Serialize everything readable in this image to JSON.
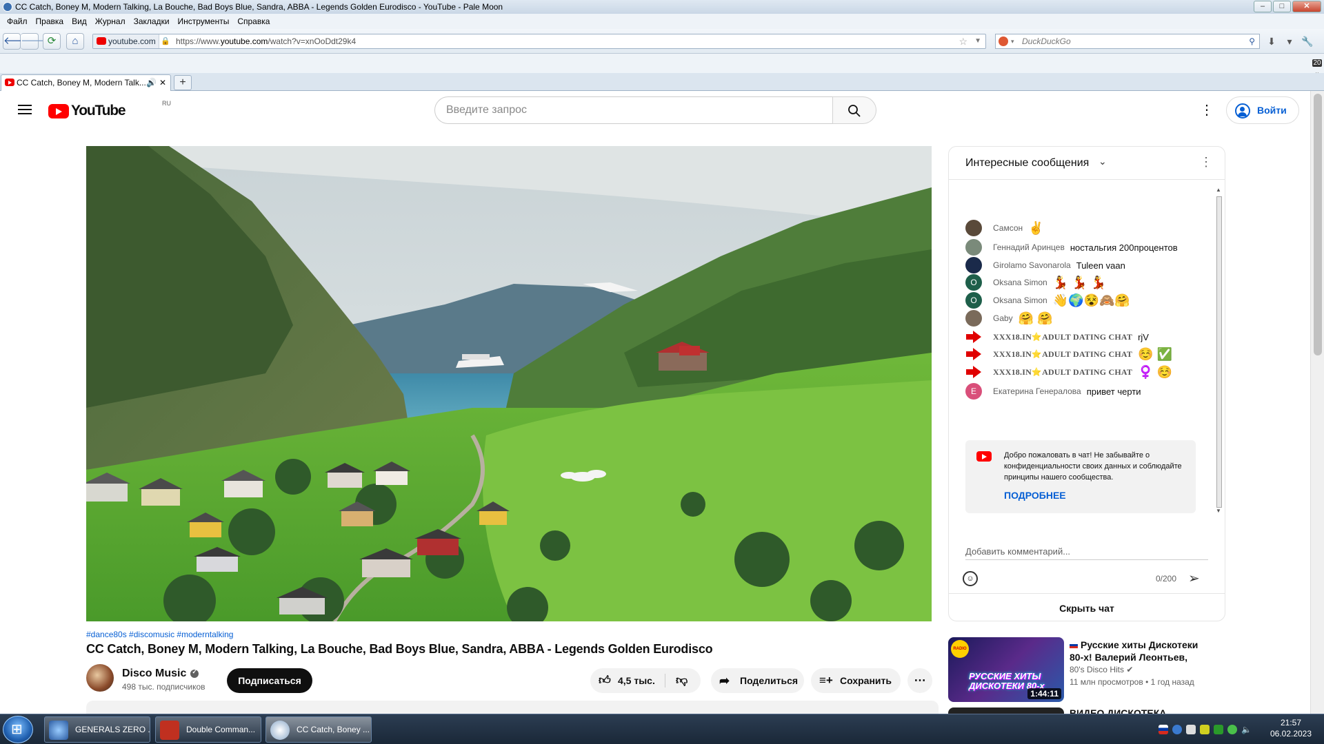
{
  "window": {
    "title": "CC Catch, Boney M, Modern Talking, La Bouche, Bad Boys Blue, Sandra, ABBA - Legends Golden Eurodisco - YouTube - Pale Moon"
  },
  "menu": [
    "Файл",
    "Правка",
    "Вид",
    "Журнал",
    "Закладки",
    "Инструменты",
    "Справка"
  ],
  "nav": {
    "site_label": "youtube.com",
    "url_prefix": "https://www.",
    "url_host": "youtube.com",
    "url_path": "/watch?v=xnOoDdt29k4",
    "search_placeholder": "DuckDuckGo"
  },
  "tab": {
    "title": "CC Catch, Boney M, Modern Talk...",
    "new_tab": "+"
  },
  "side_badge": "20",
  "youtube": {
    "logo_text": "YouTube",
    "region": "RU",
    "search_placeholder": "Введите запрос",
    "signin": "Войти"
  },
  "video": {
    "tags": "#dance80s #discomusic #moderntalking",
    "title": "CC Catch, Boney M, Modern Talking, La Bouche, Bad Boys Blue, Sandra, ABBA - Legends Golden Eurodisco",
    "channel": "Disco Music",
    "subscribers": "498 тыс. подписчиков",
    "subscribe": "Подписаться",
    "likes": "4,5 тыс.",
    "share": "Поделиться",
    "save": "Сохранить"
  },
  "chat": {
    "header": "Интересные сообщения",
    "messages": [
      {
        "author": "Самсон",
        "text": "",
        "emoji": "✌️",
        "color": "#5a4a3a"
      },
      {
        "author": "Геннадий Аринцев",
        "text": "ностальгия 200процентов",
        "emoji": "",
        "color": "#7a8a7a"
      },
      {
        "author": "Girolamo Savonarola",
        "text": "Tuleen vaan",
        "emoji": "",
        "color": "#1a2a4a"
      },
      {
        "author": "Oksana Simon",
        "text": "",
        "emoji": "💃 💃 💃",
        "color": "#1e5f4a",
        "initial": "O"
      },
      {
        "author": "Oksana Simon",
        "text": "",
        "emoji": "👋🌍😵🙈🤗",
        "color": "#1e5f4a",
        "initial": "O"
      },
      {
        "author": "Gaby",
        "text": "",
        "emoji": "🤗 🤗",
        "color": "#7a6a5a"
      },
      {
        "author": "XXX18.IN⭐ADULT DATING CHAT",
        "text": "rjV",
        "emoji": "",
        "spam": true
      },
      {
        "author": "XXX18.IN⭐ADULT DATING CHAT",
        "text": "",
        "emoji": "☺️ ✅",
        "spam": true
      },
      {
        "author": "XXX18.IN⭐ADULT DATING CHAT",
        "text": "",
        "emoji": "♀️ ☺️",
        "spam": true
      },
      {
        "author": "Екатерина Генералова",
        "text": "привет черти",
        "emoji": "",
        "color": "#d94f7a",
        "initial": "Е"
      }
    ],
    "welcome": "Добро пожаловать в чат! Не забывайте о конфиденциальности своих данных и соблюдайте принципы нашего сообщества.",
    "welcome_more": "ПОДРОБНЕЕ",
    "input_placeholder": "Добавить комментарий...",
    "counter": "0/200",
    "hide": "Скрыть чат"
  },
  "recommended": [
    {
      "title": "Русские хиты Дискотеки 80-х! Валерий Леонтьев,",
      "channel": "80's Disco Hits",
      "meta": "11 млн просмотров • 1 год назад",
      "duration": "1:44:11",
      "thumb_text": "РУССКИЕ ХИТЫ ДИСКОТЕКИ 80-х",
      "thumb_logo": "RADIO"
    },
    {
      "title": "ВИДЕО ДИСКОТЕКА"
    }
  ],
  "taskbar": {
    "items": [
      "GENERALS ZERO ...",
      "Double Comman...",
      "CC Catch, Boney ..."
    ],
    "time": "21:57",
    "date": "06.02.2023"
  }
}
